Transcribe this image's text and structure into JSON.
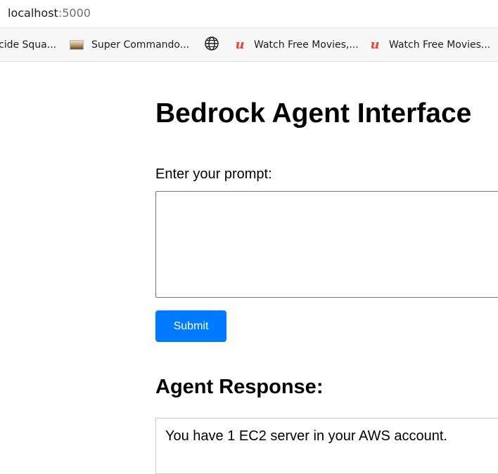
{
  "browser": {
    "address": {
      "host": "localhost",
      "port": ":5000"
    },
    "bookmarks": [
      {
        "label": "cide Squa...",
        "icon": "none"
      },
      {
        "label": "Super Commando...",
        "icon": "thumbnail-image-icon"
      },
      {
        "label": "",
        "icon": "globe-icon"
      },
      {
        "label": "Watch Free Movies,...",
        "icon": "u-logo-icon"
      },
      {
        "label": "Watch Free Movies...",
        "icon": "u-logo-icon"
      }
    ]
  },
  "page": {
    "title": "Bedrock Agent Interface",
    "prompt_label": "Enter your prompt:",
    "prompt_value": "",
    "submit_label": "Submit",
    "response_heading": "Agent Response:",
    "response_text": "You have 1 EC2 server in your AWS account."
  },
  "colors": {
    "submit_button": "#007bff",
    "u_logo": "#e8443a"
  }
}
